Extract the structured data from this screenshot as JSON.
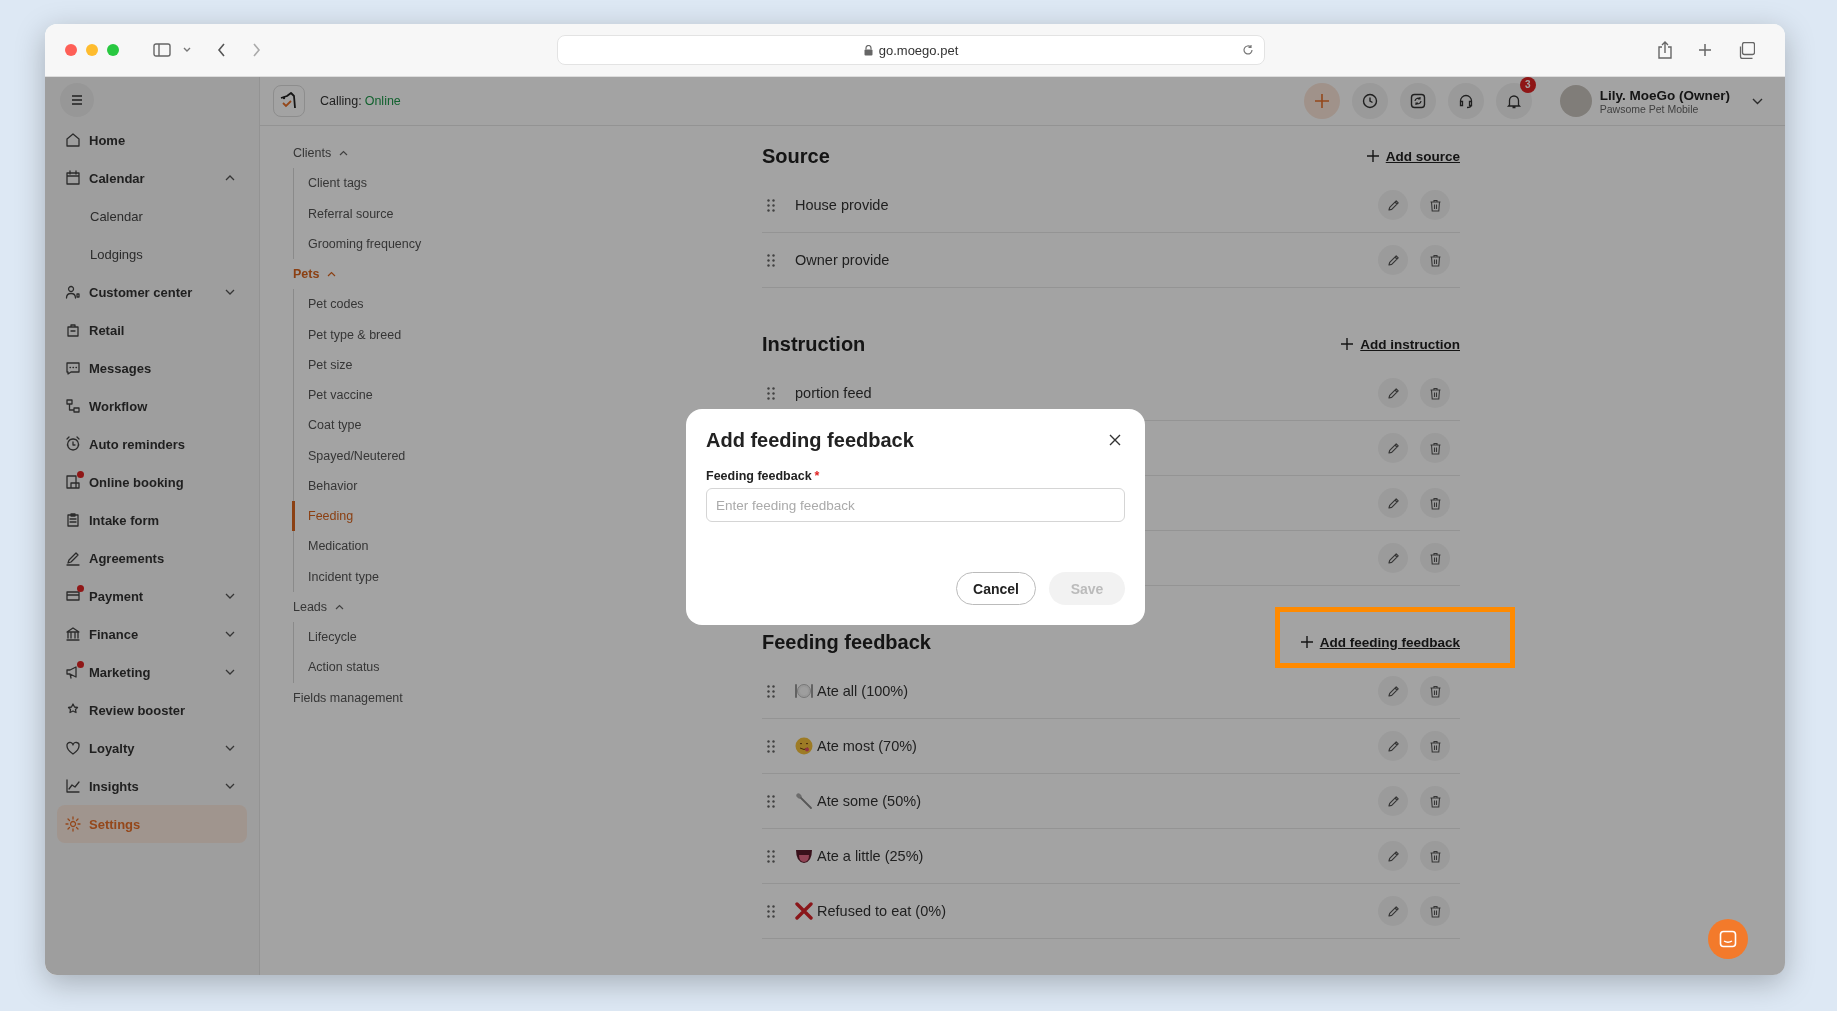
{
  "browser": {
    "url": "go.moego.pet"
  },
  "sidebar": {
    "items": [
      {
        "label": "Home",
        "selected": false,
        "dot": false
      },
      {
        "label": "Calendar",
        "selected": false,
        "dot": false,
        "expanded": true,
        "children": [
          {
            "label": "Calendar",
            "selected": false
          },
          {
            "label": "Lodgings",
            "selected": false
          }
        ]
      },
      {
        "label": "Customer center",
        "selected": false,
        "dot": false,
        "expanded": false
      },
      {
        "label": "Retail",
        "selected": false,
        "dot": false
      },
      {
        "label": "Messages",
        "selected": false,
        "dot": false
      },
      {
        "label": "Workflow",
        "selected": false,
        "dot": false
      },
      {
        "label": "Auto reminders",
        "selected": false,
        "dot": false
      },
      {
        "label": "Online booking",
        "selected": false,
        "dot": true
      },
      {
        "label": "Intake form",
        "selected": false,
        "dot": false
      },
      {
        "label": "Agreements",
        "selected": false,
        "dot": false
      },
      {
        "label": "Payment",
        "selected": false,
        "dot": true,
        "expanded": false
      },
      {
        "label": "Finance",
        "selected": false,
        "dot": false,
        "expanded": false
      },
      {
        "label": "Marketing",
        "selected": false,
        "dot": true,
        "expanded": false
      },
      {
        "label": "Review booster",
        "selected": false,
        "dot": false
      },
      {
        "label": "Loyalty",
        "selected": false,
        "dot": false,
        "expanded": false
      },
      {
        "label": "Insights",
        "selected": false,
        "dot": false,
        "expanded": false
      },
      {
        "label": "Settings",
        "selected": true,
        "dot": false
      }
    ]
  },
  "header": {
    "calling_label": "Calling:",
    "calling_status": "Online",
    "notification_count": "3",
    "user_name": "Lily. MoeGo (Owner)",
    "business": "Pawsome Pet Mobile"
  },
  "settings_nav": {
    "groups": [
      {
        "label": "Clients",
        "selected": false,
        "expanded": true,
        "children": [
          {
            "label": "Client tags",
            "selected": false
          },
          {
            "label": "Referral source",
            "selected": false
          },
          {
            "label": "Grooming frequency",
            "selected": false
          }
        ]
      },
      {
        "label": "Pets",
        "selected": true,
        "expanded": true,
        "children": [
          {
            "label": "Pet codes",
            "selected": false
          },
          {
            "label": "Pet type & breed",
            "selected": false
          },
          {
            "label": "Pet size",
            "selected": false
          },
          {
            "label": "Pet vaccine",
            "selected": false
          },
          {
            "label": "Coat type",
            "selected": false
          },
          {
            "label": "Spayed/Neutered",
            "selected": false
          },
          {
            "label": "Behavior",
            "selected": false
          },
          {
            "label": "Feeding",
            "selected": true
          },
          {
            "label": "Medication",
            "selected": false
          },
          {
            "label": "Incident type",
            "selected": false
          }
        ]
      },
      {
        "label": "Leads",
        "selected": false,
        "expanded": true,
        "children": [
          {
            "label": "Lifecycle",
            "selected": false
          },
          {
            "label": "Action status",
            "selected": false
          }
        ]
      },
      {
        "label": "Fields management",
        "selected": false
      }
    ]
  },
  "sections": [
    {
      "title": "Source",
      "add_label": "Add source",
      "highlighted": false,
      "items": [
        {
          "label": "House provide"
        },
        {
          "label": "Owner provide"
        }
      ]
    },
    {
      "title": "Instruction",
      "add_label": "Add instruction",
      "highlighted": false,
      "items": [
        {
          "label": "portion feed",
          "editable": true
        },
        {
          "editable": true
        },
        {
          "editable": true
        },
        {
          "editable": true
        }
      ]
    },
    {
      "title": "Feeding feedback",
      "add_label": "Add feeding feedback",
      "highlighted": true,
      "items": [
        {
          "label": "Ate all (100%)"
        },
        {
          "label": "Ate most (70%)"
        },
        {
          "label": "Ate some (50%)"
        },
        {
          "label": "Ate a little (25%)"
        },
        {
          "label": "Refused to eat (0%)"
        }
      ]
    }
  ],
  "dialog": {
    "title": "Add feeding feedback",
    "field": {
      "label": "Feeding feedback",
      "required_mark": "*",
      "placeholder": "Enter feeding feedback"
    },
    "buttons": [
      {
        "label": "Cancel",
        "kind": "secondary",
        "disabled": false
      },
      {
        "label": "Save",
        "kind": "primary",
        "disabled": true
      }
    ]
  }
}
